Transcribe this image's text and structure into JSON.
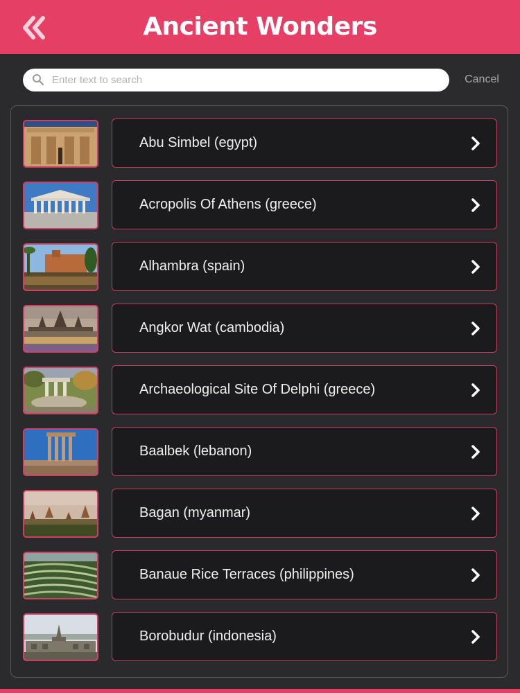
{
  "header": {
    "title": "Ancient Wonders",
    "back_icon": "double-chevron-left-icon"
  },
  "search": {
    "placeholder": "Enter text to search",
    "value": "",
    "cancel_label": "Cancel"
  },
  "colors": {
    "accent": "#e63f66",
    "background": "#2b2b2d",
    "item_background": "#1b1b1d"
  },
  "items": [
    {
      "label": "Abu Simbel (egypt)"
    },
    {
      "label": "Acropolis Of Athens (greece)"
    },
    {
      "label": "Alhambra (spain)"
    },
    {
      "label": "Angkor Wat (cambodia)"
    },
    {
      "label": "Archaeological Site Of Delphi (greece)"
    },
    {
      "label": "Baalbek (lebanon)"
    },
    {
      "label": "Bagan (myanmar)"
    },
    {
      "label": "Banaue Rice Terraces (philippines)"
    },
    {
      "label": "Borobudur (indonesia)"
    }
  ]
}
